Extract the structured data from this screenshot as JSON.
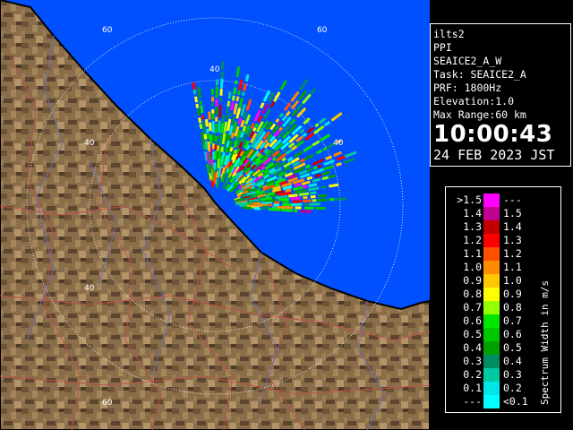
{
  "info": {
    "station": "ilts2",
    "scan_type": "PPI",
    "scan_name": "SEAICE2_A_W",
    "task": "Task: SEAICE2_A",
    "prf": "PRF: 1800Hz",
    "elevation": "Elevation:1.0",
    "max_range": "Max Range:60 km",
    "time": "10:00:43",
    "date": "24 FEB 2023 JST"
  },
  "legend": {
    "title": "Spectrum Width in m/s",
    "rows": [
      {
        "left": ">1.5",
        "right": "---",
        "color": "#ff00ff"
      },
      {
        "left": "1.4",
        "right": "1.5",
        "color": "#c00090"
      },
      {
        "left": "1.3",
        "right": "1.4",
        "color": "#c00000"
      },
      {
        "left": "1.2",
        "right": "1.3",
        "color": "#ff0000"
      },
      {
        "left": "1.1",
        "right": "1.2",
        "color": "#ff5000"
      },
      {
        "left": "1.0",
        "right": "1.1",
        "color": "#ff8c00"
      },
      {
        "left": "0.9",
        "right": "1.0",
        "color": "#ffc800"
      },
      {
        "left": "0.8",
        "right": "0.9",
        "color": "#ffff00"
      },
      {
        "left": "0.7",
        "right": "0.8",
        "color": "#96ff00"
      },
      {
        "left": "0.6",
        "right": "0.7",
        "color": "#00e600"
      },
      {
        "left": "0.5",
        "right": "0.6",
        "color": "#00c800"
      },
      {
        "left": "0.4",
        "right": "0.5",
        "color": "#00a000"
      },
      {
        "left": "0.3",
        "right": "0.4",
        "color": "#008c64"
      },
      {
        "left": "0.2",
        "right": "0.3",
        "color": "#00c8a0"
      },
      {
        "left": "0.1",
        "right": "0.2",
        "color": "#00e6e6"
      },
      {
        "left": "---",
        "right": "<0.1",
        "color": "#00ffff"
      }
    ]
  },
  "range_rings": {
    "labels": [
      "60",
      "40",
      "40",
      "40",
      "40",
      "60",
      "60"
    ],
    "unit_km": 20
  },
  "colors": {
    "sea": "#0050ff",
    "land": "#8a6e4a",
    "coast": "#000000",
    "roads": "#c0504a",
    "rivers": "#6e6eb4",
    "rings": "#ffffff"
  }
}
